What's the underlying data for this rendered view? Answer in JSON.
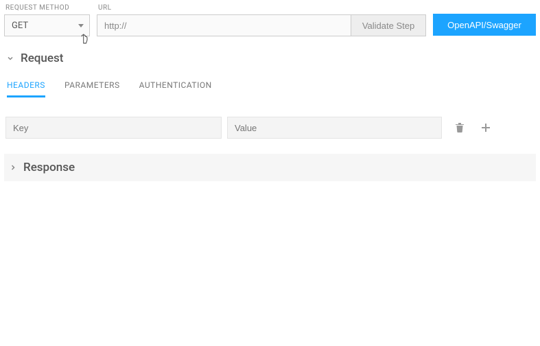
{
  "labels": {
    "request_method": "REQUEST METHOD",
    "url": "URL"
  },
  "method": {
    "selected": "GET"
  },
  "url_input": {
    "value": "http://"
  },
  "buttons": {
    "validate": "Validate Step",
    "swagger": "OpenAPI/Swagger"
  },
  "sections": {
    "request": "Request",
    "response": "Response"
  },
  "tabs": {
    "headers": "HEADERS",
    "parameters": "PARAMETERS",
    "authentication": "AUTHENTICATION"
  },
  "kv": {
    "key_placeholder": "Key",
    "value_placeholder": "Value"
  }
}
